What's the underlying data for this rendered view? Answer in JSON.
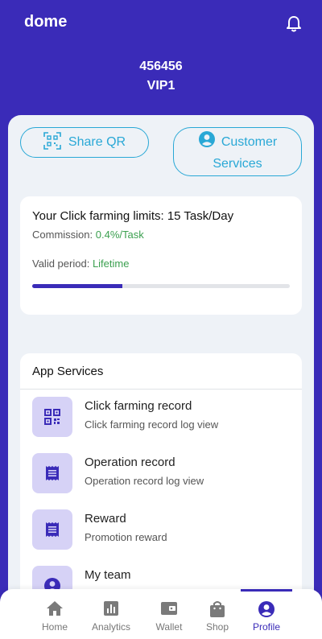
{
  "app": {
    "brand": "dome"
  },
  "user": {
    "id": "456456",
    "vip_level": "VIP1"
  },
  "actions": {
    "share_qr_label": "Share QR",
    "customer_services_line1": "Customer",
    "customer_services_line2": "Services"
  },
  "limits": {
    "title": "Your Click farming limits: 15 Task/Day",
    "commission_label": "Commission:",
    "commission_value": "0.4%/Task",
    "valid_label": "Valid period:",
    "valid_value": "Lifetime",
    "progress_fraction": 0.35
  },
  "services": {
    "header": "App Services",
    "items": [
      {
        "title": "Click farming record",
        "subtitle": "Click farming record log view",
        "icon": "qr-icon"
      },
      {
        "title": "Operation record",
        "subtitle": "Operation record log view",
        "icon": "receipt-icon"
      },
      {
        "title": "Reward",
        "subtitle": "Promotion reward",
        "icon": "receipt-icon"
      },
      {
        "title": "My team",
        "subtitle": "",
        "icon": "person-icon"
      }
    ]
  },
  "nav": {
    "items": [
      {
        "label": "Home",
        "icon": "home-icon"
      },
      {
        "label": "Analytics",
        "icon": "analytics-icon"
      },
      {
        "label": "Wallet",
        "icon": "wallet-icon"
      },
      {
        "label": "Shop",
        "icon": "shop-icon"
      },
      {
        "label": "Profile",
        "icon": "profile-icon"
      }
    ],
    "active": "Profile"
  },
  "colors": {
    "brand": "#3a2bb8",
    "accent": "#29a8d6",
    "positive": "#3ca050",
    "panel": "#eef2f7",
    "icon_bg": "#d6d2f6"
  }
}
